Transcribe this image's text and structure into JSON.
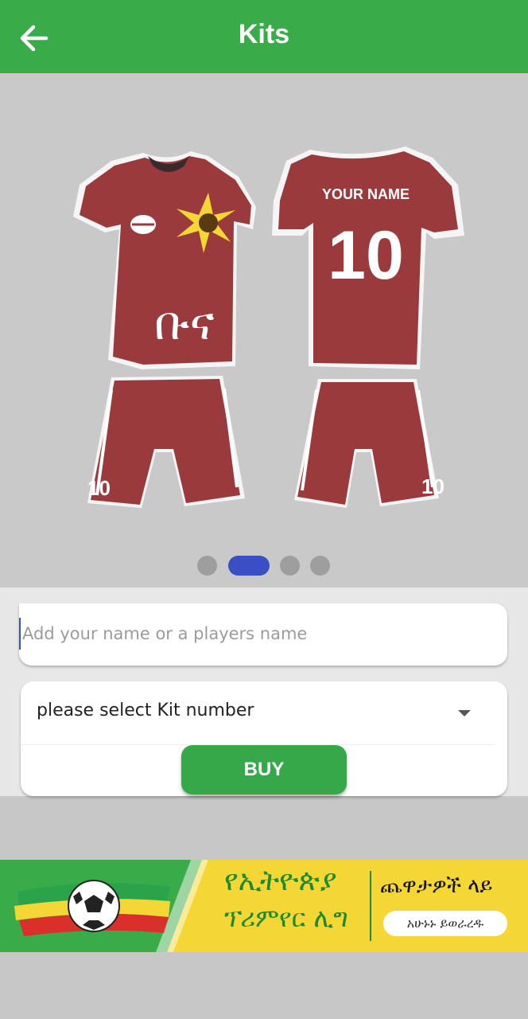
{
  "appbar": {
    "title": "Kits",
    "back_icon": "arrow-left-icon",
    "color": "#3aab49"
  },
  "kits": {
    "front_jersey_text": "ቡና",
    "back_name": "YOUR NAME",
    "back_number": "10",
    "shorts_number": "10",
    "kit_color": "#9b3a3c"
  },
  "carousel": {
    "pages": 4,
    "active_index": 1,
    "active_color": "#3a4fc4"
  },
  "form": {
    "name_placeholder": "Add your name or a players name",
    "name_value": "",
    "kit_number_placeholder": "please select Kit number",
    "buy_label": "BUY"
  },
  "banner": {
    "title_line1": "የኢትዮጵያ",
    "title_line2": "ፕሪምየር ሊግ",
    "right_text": "ጨዋታዎች ላይ",
    "pill_text": "አሁኑኑ ይወራረዱ"
  }
}
